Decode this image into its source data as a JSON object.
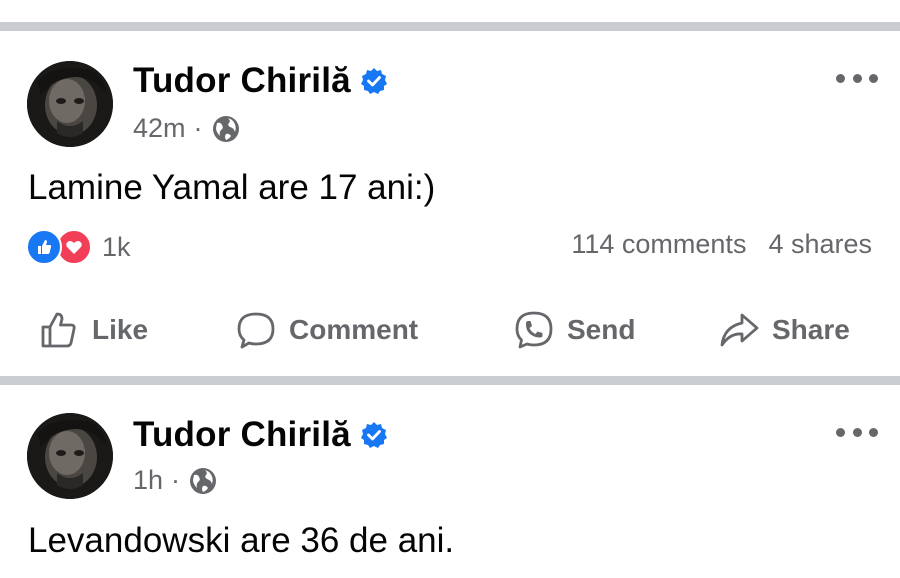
{
  "posts": [
    {
      "author": "Tudor Chirilă",
      "time": "42m",
      "meta_separator": "·",
      "text": "Lamine Yamal are 17 ani:)",
      "reaction_count": "1k",
      "comments": "114 comments",
      "shares": "4 shares",
      "actions": {
        "like": "Like",
        "comment": "Comment",
        "send": "Send",
        "share": "Share"
      }
    },
    {
      "author": "Tudor Chirilă",
      "time": "1h",
      "meta_separator": "·",
      "text": "Levandowski are 36 de ani."
    }
  ],
  "colors": {
    "accent": "#1877f2",
    "love": "#f33e58",
    "secondary_text": "#65676b",
    "divider": "#c9ccd1"
  },
  "icons": {
    "verified": "verified-badge-icon",
    "privacy": "globe-icon",
    "more": "more-options-icon",
    "like_reaction": "like-reaction-icon",
    "love_reaction": "love-reaction-icon",
    "like_action": "thumbs-up-icon",
    "comment_action": "comment-bubble-icon",
    "send_action": "messenger-icon",
    "share_action": "share-arrow-icon"
  }
}
